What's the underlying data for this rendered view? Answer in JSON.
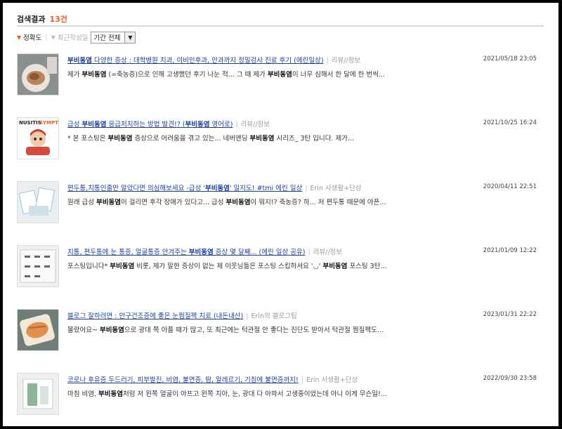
{
  "header": {
    "title": "검색결과",
    "count": "13건"
  },
  "sort": {
    "accuracy": "정확도",
    "recent": "최근작성일",
    "period": "기간 전체"
  },
  "results": [
    {
      "title": [
        "부비동염",
        " 다양한 증상 : 대학병원 치과, 이비인후과, 안과까지 정밀검사 진료 후기 (에린일상)"
      ],
      "category": "리뷰//정보",
      "date": "2021/05/18 23:05",
      "snippet": [
        "제가 ",
        "부비동염",
        " (=축농증)으로 인해 고생했던 후기 나눈 적... 그 때 제가 ",
        "부비동염",
        "이 너무 심해서 한 달에 한 번씩..."
      ]
    },
    {
      "title": [
        "급성 ",
        "부비동염",
        " 응급처치하는 방법 발견!? (",
        "부비동염",
        " 영어로)"
      ],
      "category": "리뷰//정보",
      "date": "2021/10/25 16:24",
      "snippet": [
        "* 본 포스팅은 ",
        "부비동염",
        " 증상으로 어려움을 겪고 있는... 네버엔딩 ",
        "부비동염",
        " 시리즈_ 3탄 입니다. 제가..."
      ]
    },
    {
      "title": [
        "편두통,치통인줄만 알았다면 의심해보세요 -급성 '",
        "부비동염",
        "' 일지도! #tmi 에린 일상"
      ],
      "category": "Erin 사생활+단상",
      "date": "2020/04/11 22:51",
      "snippet": [
        "원래 급성 ",
        "부비동염",
        "이 걸리면 후각 장애가 있다고... 급성 ",
        "부비동염",
        "이 뭐지!? 축농증? 하... 저 편두통 때문에 아픈..."
      ]
    },
    {
      "title": [
        "치통, 편두통에 눈 통증, 얼굴통증 안겨주는 ",
        "부비동염",
        " 증상 몇 달째... (에린 일상 공유)"
      ],
      "category": "리뷰//정보",
      "date": "2021/01/09 12:22",
      "snippet": [
        "포스팅입니다* ",
        "부비동염",
        " 비롯, 제가 말한 증상이 없는 제 이웃님들은 포스팅 스킵하셔요 '◡' ",
        "부비동염",
        " 포스팅 3탄..."
      ]
    },
    {
      "title": [
        "블로그 잘하려면 : 안구건조증에 좋은 눈찜질팩 치료 (내돈내산)"
      ],
      "category": "Erin의 블로그팁",
      "date": "2023/01/31 22:22",
      "snippet": [
        "몰랐어요~ ",
        "부비동염",
        "으로 광대 쪽 아플 때가 많고, 또 최근에는 턱관절 안 좋다는 진단도 받아서 턱관절 찜질팩도..."
      ]
    },
    {
      "title": [
        "코로나 후유증 두드러기, 피부발진, 비염, 불면증, 땀, 알레르기, 기침에 불면증까지!"
      ],
      "category": "Erin 사생활+단상",
      "date": "2022/09/30 23:58",
      "snippet": [
        "마침 비염, ",
        "부비동염",
        "처럼 저 왼쪽 얼굴이 아프고 왼쪽 치아, 눈, 광대 다 아파서 고생중이었는데 아니 이게 무슨일!..."
      ]
    }
  ],
  "thumb_icons": [
    "food-plate-thumbnail",
    "nusitis-symptom-thumbnail",
    "medicine-pills-thumbnail",
    "pill-packet-thumbnail",
    "bread-pack-thumbnail",
    "medicine-box-thumbnail"
  ],
  "thumb_text": {
    "nusitis": "NUSITIS",
    "sympto": "SYMPTO"
  },
  "colors": {
    "accent": "#f15a22",
    "link": "#1a3fa0"
  }
}
